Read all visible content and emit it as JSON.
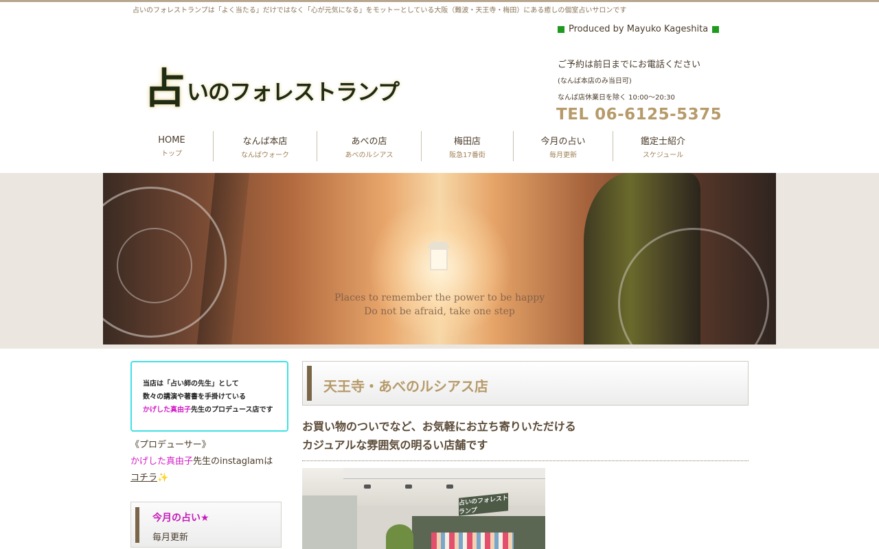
{
  "header": {
    "tagline": "占いのフォレストランプは「よく当たる」だけではなく「心が元気になる」をモットーとしている大阪（難波・天王寺・梅田）にある癒しの個室占いサロンです",
    "logo_big": "占",
    "logo_rest": "いのフォレストランプ",
    "produced_by": "Produced by Mayuko Kageshita",
    "reserve_note": "ご予約は前日までにお電話ください",
    "reserve_sub": "(なんば本店のみ当日可)",
    "hours": "なんば店休業日を除く 10:00〜20:30",
    "tel": "TEL 06-6125-5375",
    "accent_color": "#b69a69",
    "marker_color": "#1f9a1f"
  },
  "nav": {
    "items": [
      {
        "label": "HOME",
        "sub": "トップ"
      },
      {
        "label": "なんば本店",
        "sub": "なんばウォーク"
      },
      {
        "label": "あべの店",
        "sub": "あべのルシアス"
      },
      {
        "label": "梅田店",
        "sub": "阪急17番街"
      },
      {
        "label": "今月の占い",
        "sub": "毎月更新"
      },
      {
        "label": "鑑定士紹介",
        "sub": "スケジュール"
      }
    ]
  },
  "hero": {
    "line1": "Places to remember the power to be happy",
    "line2": "Do not be afraid, take one step"
  },
  "sidebar": {
    "promo": {
      "line1": "当店は「占い師の先生」として",
      "line2": "数々の講演や著書を手掛けている",
      "line3_highlight": "かげした真由子",
      "line3_rest": "先生のプロデュース店です",
      "border_color": "#3ee0e6"
    },
    "producer_label": "《プロデューサー》",
    "producer_name": "かげした真由子",
    "producer_rest": "先生のinstaglamは",
    "producer_link": "コチラ",
    "producer_emoji": "✨",
    "card": {
      "title": "今月の占い★",
      "sub": "毎月更新"
    },
    "highlight_color": "#d31cc7"
  },
  "main": {
    "heading": "天王寺・あべのルシアス店",
    "intro_line1": "お買い物のついでなど、お気軽にお立ち寄りいただける",
    "intro_line2": "カジュアルな雰囲気の明るい店舗です",
    "photo_sign": "占いのフォレストランプ"
  }
}
